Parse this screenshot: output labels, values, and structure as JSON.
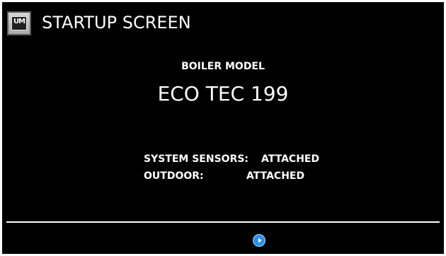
{
  "header": {
    "title": "STARTUP SCREEN",
    "logo_text": "UM",
    "logo_icon": "logo-icon"
  },
  "boiler": {
    "label": "BOILER MODEL",
    "value": "ECO TEC 199"
  },
  "status": {
    "system_sensors_label": "SYSTEM SENSORS:",
    "system_sensors_value": "ATTACHED",
    "outdoor_label": "OUTDOOR:",
    "outdoor_value": "ATTACHED"
  },
  "footer": {
    "next_icon": "play-icon"
  },
  "colors": {
    "background": "#000000",
    "text": "#ffffff",
    "accent": "#2f8fe7"
  }
}
